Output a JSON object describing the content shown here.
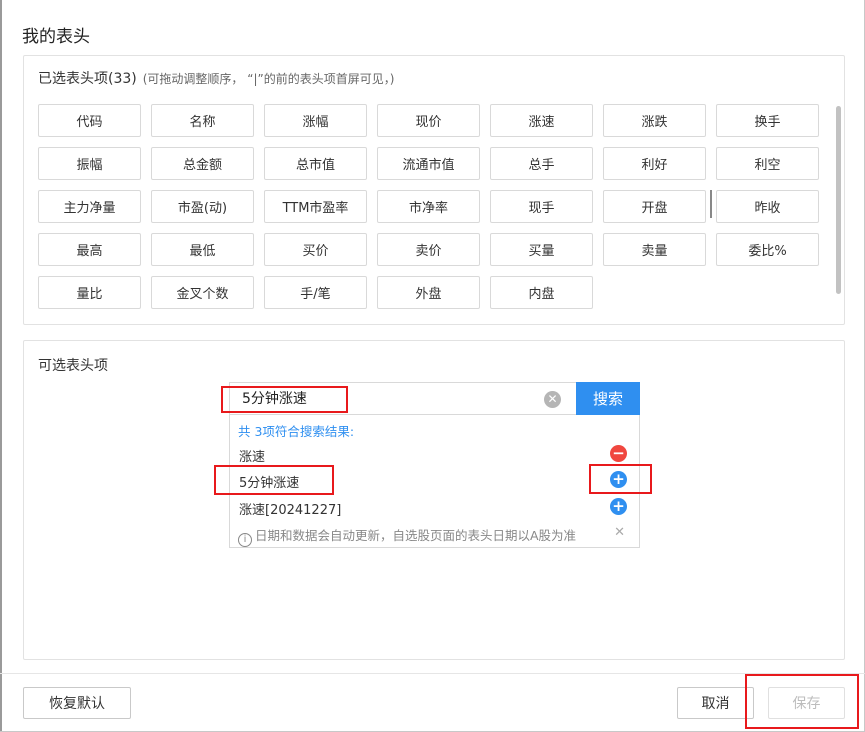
{
  "dialog": {
    "title": "我的表头"
  },
  "selected": {
    "heading": "已选表头项(33)",
    "hint": "(可拖动调整顺序，  “|”的前的表头项首屏可见，)",
    "items": [
      "代码",
      "名称",
      "涨幅",
      "现价",
      "涨速",
      "涨跌",
      "换手",
      "振幅",
      "总金额",
      "总市值",
      "流通市值",
      "总手",
      "利好",
      "利空",
      "主力净量",
      "市盈(动)",
      "TTM市盈率",
      "市净率",
      "现手",
      "开盘",
      "昨收",
      "最高",
      "最低",
      "买价",
      "卖价",
      "买量",
      "卖量",
      "委比%",
      "量比",
      "金叉个数",
      "手/笔",
      "外盘",
      "内盘"
    ]
  },
  "available": {
    "heading": "可选表头项",
    "search": {
      "value": "5分钟涨速",
      "button_label": "搜索"
    },
    "results": {
      "summary": "共 3项符合搜索结果:",
      "rows": [
        {
          "label": "涨速",
          "action": "remove"
        },
        {
          "label": "5分钟涨速",
          "action": "add"
        },
        {
          "label": "涨速[20241227]",
          "action": "add"
        }
      ],
      "info": "日期和数据会自动更新，自选股页面的表头日期以A股为准"
    }
  },
  "footer": {
    "reset_label": "恢复默认",
    "cancel_label": "取消",
    "save_label": "保存"
  },
  "colors": {
    "accent": "#2f8ff0",
    "remove": "#f0473f",
    "highlight": "#e8191c"
  },
  "icons": {
    "clear": "clear-icon",
    "remove": "minus-circle-icon",
    "add": "plus-circle-icon",
    "info": "info-icon",
    "close": "close-icon"
  }
}
